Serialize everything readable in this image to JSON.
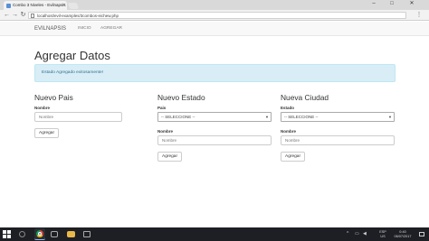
{
  "browser": {
    "tab_title": "Combo 3 Niveles - Evilnapsis",
    "tab_close": "×",
    "url": "localhost/evil-examples/3combos-eichew.php",
    "window_controls": {
      "minimize": "–",
      "maximize": "□",
      "close": "✕"
    },
    "menu_glyph": "⋮"
  },
  "navbar": {
    "brand": "EVILNAPSIS",
    "links": [
      "INICIO",
      "AGREGAR"
    ]
  },
  "page": {
    "title": "Agregar Datos",
    "alert": "Estado Agregado exitosamente!"
  },
  "forms": {
    "pais": {
      "heading": "Nuevo Pais",
      "label_nombre": "Nombre",
      "placeholder_nombre": "Nombre",
      "button": "Agregar"
    },
    "estado": {
      "heading": "Nuevo Estado",
      "label_pais": "Pais",
      "select_pais": "-- SELECCIONE --",
      "label_nombre": "Nombre",
      "placeholder_nombre": "Nombre",
      "button": "Agregar"
    },
    "ciudad": {
      "heading": "Nueva Ciudad",
      "label_estado": "Estado",
      "select_estado": "-- SELECCIONE --",
      "label_nombre": "Nombre",
      "placeholder_nombre": "Nombre",
      "button": "Agregar"
    }
  },
  "taskbar": {
    "lang": "ESP",
    "lang_sub": "US",
    "time": "0:40",
    "date": "06/07/2017"
  },
  "colors": {
    "alert_bg": "#d9edf7",
    "alert_text": "#31708f",
    "navbar_bg": "#f8f8f8",
    "taskbar_bg": "#1d1f24"
  }
}
